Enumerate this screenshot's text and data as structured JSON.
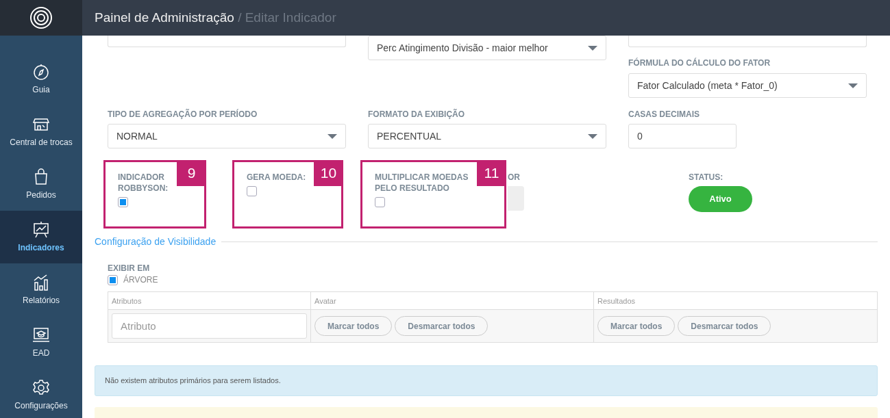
{
  "header": {
    "title": "Painel de Administração",
    "separator": "/",
    "subtitle": "Editar Indicador"
  },
  "sidebar": {
    "items": [
      {
        "label": "Guia",
        "selected": false
      },
      {
        "label": "Central de trocas",
        "selected": false
      },
      {
        "label": "Pedidos",
        "selected": false
      },
      {
        "label": "Indicadores",
        "selected": true
      },
      {
        "label": "Relatórios",
        "selected": false
      },
      {
        "label": "EAD",
        "selected": false
      },
      {
        "label": "Configurações",
        "selected": false
      }
    ]
  },
  "top_row": [
    {
      "kind": "cut"
    },
    {
      "kind": "select",
      "value": "Perc Atingimento Divisão - maior melhor"
    },
    {
      "kind": "cut"
    }
  ],
  "formula": {
    "label": "FÓRMULA DO CÁLCULO DO FATOR",
    "value": "Fator Calculado (meta * Fator_0)"
  },
  "second_row": [
    {
      "kind": "select",
      "label": "TIPO DE AGREGAÇÃO POR PERÍODO",
      "value": "NORMAL"
    },
    {
      "kind": "select",
      "label": "FORMATO DA EXIBIÇÃO",
      "value": "PERCENTUAL"
    },
    {
      "kind": "input",
      "label": "CASAS DECIMAIS",
      "value": "0"
    }
  ],
  "flags": [
    {
      "label": "INDICADOR ROBBYSON:",
      "checked": true,
      "marker": "9"
    },
    {
      "label": "GERA MOEDA:",
      "checked": false,
      "marker": "10"
    },
    {
      "label": "MULTIPLICAR MOEDAS PELO RESULTADO",
      "checked": false,
      "marker": "11"
    }
  ],
  "color_field": {
    "label": "OR"
  },
  "status": {
    "label": "STATUS:",
    "value": "Ativo",
    "on": true
  },
  "visibility": {
    "title": "Configuração de Visibilidade",
    "label": "EXIBIR EM",
    "options": [
      {
        "label": "ÁRVORE",
        "checked": true
      }
    ],
    "table": {
      "columns": [
        "Atributos",
        "Avatar",
        "Resultados"
      ],
      "placeholder": "Atributo",
      "button_groups": [
        [
          "Marcar todos",
          "Desmarcar todos"
        ],
        [
          "Marcar todos",
          "Desmarcar todos"
        ]
      ]
    }
  },
  "alerts": [
    {
      "kind": "info",
      "text": "Não existem atributos primários para serem listados."
    },
    {
      "kind": "warning"
    }
  ]
}
